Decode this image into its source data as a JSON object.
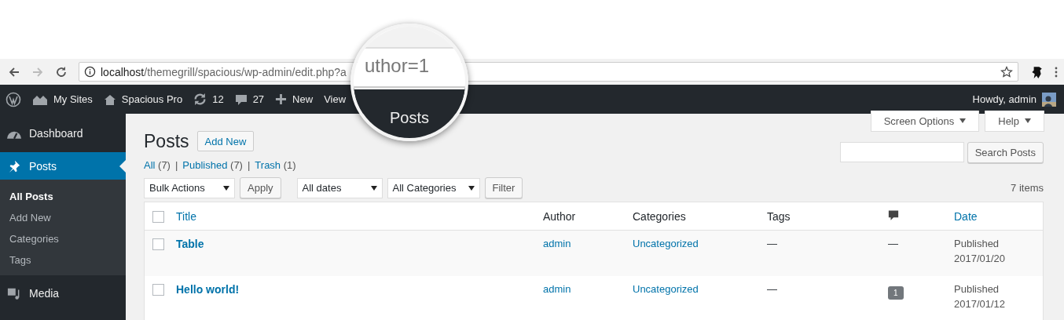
{
  "browser": {
    "url_host": "localhost",
    "url_path": "/themegrill/spacious/wp-admin/edit.php?a"
  },
  "magnifier": {
    "url_text": "uthor=1",
    "heading": "Posts"
  },
  "admin_bar": {
    "items": [
      {
        "kind": "my-sites",
        "label": "My Sites"
      },
      {
        "kind": "home",
        "label": "Spacious Pro"
      },
      {
        "kind": "updates",
        "label": "12"
      },
      {
        "kind": "comments",
        "label": "27"
      },
      {
        "kind": "new",
        "label": "New"
      },
      {
        "kind": "plain",
        "label": "View"
      }
    ],
    "greeting": "Howdy, admin"
  },
  "sidebar": {
    "items": [
      {
        "kind": "dashboard",
        "label": "Dashboard",
        "selected": false
      },
      {
        "kind": "posts",
        "label": "Posts",
        "selected": true,
        "children": [
          {
            "label": "All Posts",
            "selected": true
          },
          {
            "label": "Add New",
            "selected": false
          },
          {
            "label": "Categories",
            "selected": false
          },
          {
            "label": "Tags",
            "selected": false
          }
        ]
      },
      {
        "kind": "media",
        "label": "Media",
        "selected": false
      }
    ]
  },
  "header": {
    "title": "Posts",
    "add_new": "Add New",
    "screen_options": "Screen Options",
    "help": "Help"
  },
  "views": [
    {
      "label": "All",
      "count": "(7)"
    },
    {
      "separator": "|",
      "label": "Published",
      "count": "(7)"
    },
    {
      "separator": "|",
      "label": "Trash",
      "count": "(1)"
    }
  ],
  "search": {
    "button": "Search Posts"
  },
  "filters": {
    "bulk": "Bulk Actions",
    "apply": "Apply",
    "dates": "All dates",
    "categories": "All Categories",
    "filter": "Filter",
    "count": "7 items"
  },
  "table": {
    "select_all": {
      "checked": false
    },
    "columns": [
      {
        "label": "Title",
        "kind": "sortable"
      },
      {
        "label": "Author",
        "kind": "text"
      },
      {
        "label": "Categories",
        "kind": "text"
      },
      {
        "label": "Tags",
        "kind": "text"
      },
      {
        "kind": "comment-icon"
      },
      {
        "label": "Date",
        "kind": "sortable"
      }
    ],
    "rows": [
      {
        "checked": false,
        "title": "Table",
        "author": "admin",
        "category": "Uncategorized",
        "tags": "—",
        "comments": {
          "kind": "none",
          "text": "—"
        },
        "status": "Published",
        "date": "2017/01/20"
      },
      {
        "checked": false,
        "title": "Hello world!",
        "author": "admin",
        "category": "Uncategorized",
        "tags": "—",
        "comments": {
          "kind": "count",
          "text": "1"
        },
        "status": "Published",
        "date": "2017/01/12"
      }
    ]
  }
}
